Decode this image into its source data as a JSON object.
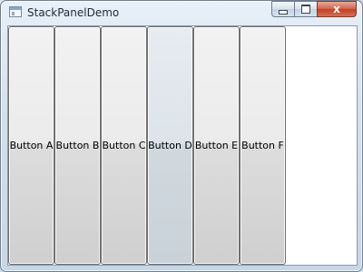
{
  "window": {
    "title": "StackPanelDemo",
    "caption_buttons": {
      "close_label": "x"
    }
  },
  "stack_panel": {
    "buttons": [
      {
        "label": "Button A"
      },
      {
        "label": "Button B"
      },
      {
        "label": "Button C"
      },
      {
        "label": "Button D"
      },
      {
        "label": "Button E"
      },
      {
        "label": "Button F"
      }
    ]
  }
}
